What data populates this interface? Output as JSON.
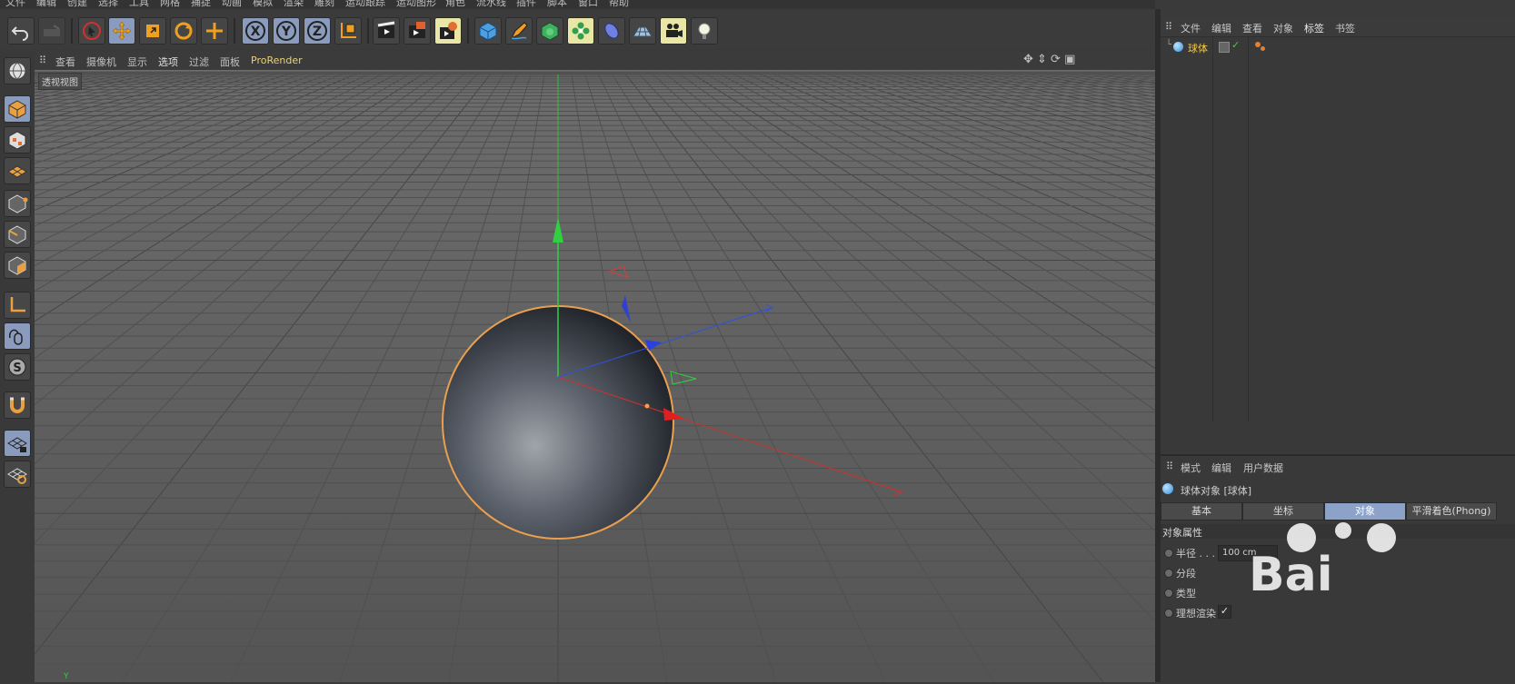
{
  "menubar": {
    "items": [
      "文件",
      "编辑",
      "创建",
      "选择",
      "工具",
      "网格",
      "捕捉",
      "动画",
      "模拟",
      "渲染",
      "雕刻",
      "运动跟踪",
      "运动图形",
      "角色",
      "流水线",
      "插件",
      "脚本",
      "窗口",
      "帮助"
    ]
  },
  "toolbar": {
    "buttons": [
      "undo-icon",
      "redo-icon",
      "live-select-icon",
      "move-icon",
      "scale-icon",
      "rotate-icon",
      "recent-tool-icon",
      "x-axis-icon",
      "y-axis-icon",
      "z-axis-icon",
      "coordinate-system-icon",
      "render-view-icon",
      "render-picture-viewer-icon",
      "edit-render-settings-icon",
      "cube-icon",
      "pen-icon",
      "subdivision-icon",
      "mograph-icon",
      "deformer-icon",
      "floor-icon",
      "camera-icon",
      "light-icon"
    ],
    "axis_labels": [
      "X",
      "Y",
      "Z"
    ]
  },
  "left_toolbar": {
    "buttons": [
      "make-editable-icon",
      "model-mode-icon",
      "texture-mode-icon",
      "workplane-icon",
      "points-mode-icon",
      "edges-mode-icon",
      "polygons-mode-icon",
      "axis-mode-icon",
      "tweak-mode-icon",
      "solo-icon",
      "snap-icon",
      "locked-workplane-icon",
      "planar-workplane-icon"
    ]
  },
  "viewport": {
    "menu": [
      "查看",
      "摄像机",
      "显示",
      "选项",
      "过滤",
      "面板",
      "ProRender"
    ],
    "label": "透视视图",
    "axis_indicator": "Y"
  },
  "object_manager": {
    "menu": [
      "文件",
      "编辑",
      "查看",
      "对象",
      "标签",
      "书签"
    ],
    "objects": [
      {
        "name": "球体"
      }
    ]
  },
  "attribute_manager": {
    "menu": [
      "模式",
      "编辑",
      "用户数据"
    ],
    "title": "球体对象 [球体]",
    "tabs": [
      "基本",
      "坐标",
      "对象",
      "平滑着色(Phong)"
    ],
    "active_tab": "对象",
    "section": "对象属性",
    "properties": [
      {
        "label": "半径 . . .",
        "value": "100 cm"
      },
      {
        "label": "分段",
        "value": ""
      },
      {
        "label": "类型",
        "value": ""
      },
      {
        "label": "理想渲染",
        "value": "✓"
      }
    ]
  },
  "watermark": "Bai",
  "colors": {
    "accent": "#8ca2c8",
    "highlight_yellow": "#eae7a6",
    "selection_orange": "#f0a050",
    "axis_x": "#e03030",
    "axis_y": "#30d040",
    "axis_z": "#2a40e0"
  }
}
